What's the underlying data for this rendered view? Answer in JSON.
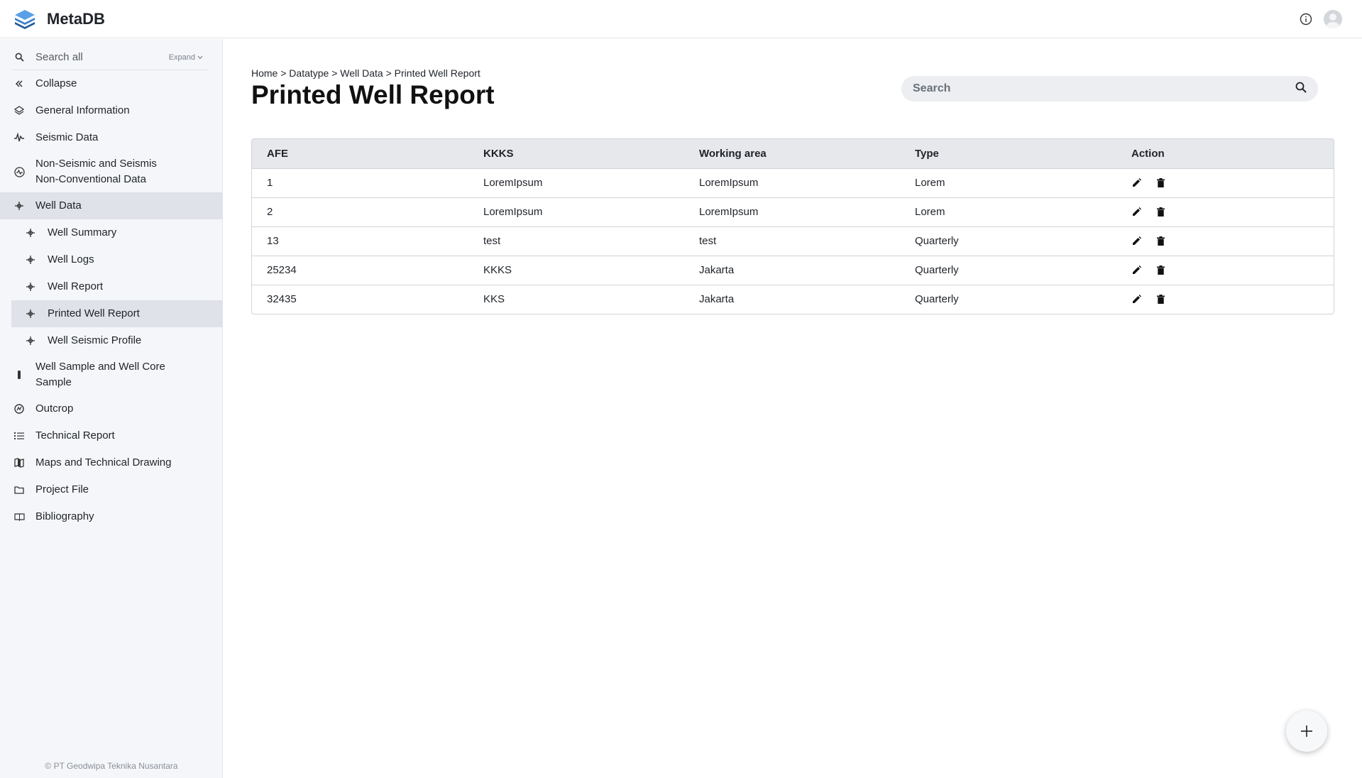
{
  "app": {
    "title": "MetaDB"
  },
  "sidebar": {
    "search_placeholder": "Search all",
    "expand_label": "Expand",
    "collapse_label": "Collapse",
    "items": [
      {
        "label": "General Information",
        "icon": "layers-icon"
      },
      {
        "label": "Seismic Data",
        "icon": "waveform-icon"
      },
      {
        "label": "Non-Seismic and Seismis Non-Conventional Data",
        "icon": "radar-icon"
      },
      {
        "label": "Well Data",
        "icon": "well-icon",
        "active": true
      },
      {
        "label": "Well Summary",
        "icon": "well-icon",
        "sub": true
      },
      {
        "label": "Well Logs",
        "icon": "well-icon",
        "sub": true
      },
      {
        "label": "Well Report",
        "icon": "well-icon",
        "sub": true
      },
      {
        "label": "Printed Well Report",
        "icon": "well-icon",
        "sub": true,
        "active": true
      },
      {
        "label": "Well Seismic Profile",
        "icon": "well-icon",
        "sub": true
      },
      {
        "label": "Well Sample and Well Core Sample",
        "icon": "core-sample-icon"
      },
      {
        "label": "Outcrop",
        "icon": "outcrop-icon"
      },
      {
        "label": "Technical Report",
        "icon": "list-icon"
      },
      {
        "label": "Maps and Technical Drawing",
        "icon": "map-icon"
      },
      {
        "label": "Project File",
        "icon": "folder-icon"
      },
      {
        "label": "Bibliography",
        "icon": "book-icon"
      }
    ],
    "footer": "© PT Geodwipa Teknika Nusantara"
  },
  "main": {
    "breadcrumb": "Home > Datatype > Well Data > Printed Well Report",
    "title": "Printed Well Report",
    "search_placeholder": "Search",
    "table": {
      "columns": [
        "AFE",
        "KKKS",
        "Working area",
        "Type",
        "Action"
      ],
      "rows": [
        [
          "1",
          "LoremIpsum",
          "LoremIpsum",
          "Lorem"
        ],
        [
          "2",
          "LoremIpsum",
          "LoremIpsum",
          "Lorem"
        ],
        [
          "13",
          "test",
          "test",
          "Quarterly"
        ],
        [
          "25234",
          "KKKS",
          "Jakarta",
          "Quarterly"
        ],
        [
          "32435",
          "KKS",
          "Jakarta",
          "Quarterly"
        ]
      ]
    }
  },
  "colors": {
    "sidebar_bg": "#f4f6f9",
    "active_bg": "#dfe2e8",
    "header_bg": "#e6e8ec",
    "logo_blue": "#2f6fb5"
  }
}
